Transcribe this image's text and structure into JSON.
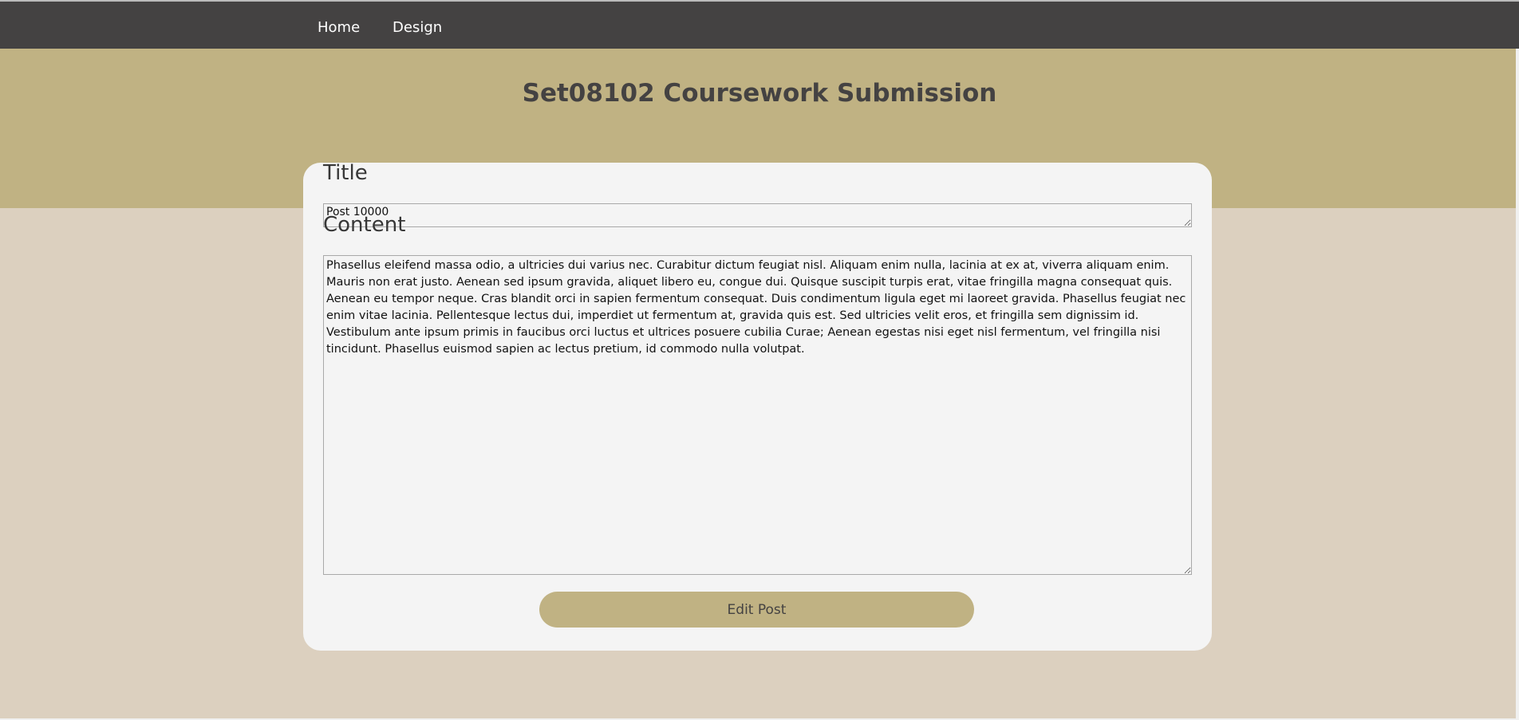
{
  "nav": {
    "items": [
      {
        "label": "Home"
      },
      {
        "label": "Design"
      }
    ]
  },
  "header": {
    "title": "Set08102 Coursework Submission"
  },
  "form": {
    "title_label": "Title",
    "title_value": "Post 10000",
    "content_label": "Content",
    "content_value": "Phasellus eleifend massa odio, a ultricies dui varius nec. Curabitur dictum feugiat nisl. Aliquam enim nulla, lacinia at ex at, viverra aliquam enim. Mauris non erat justo. Aenean sed ipsum gravida, aliquet libero eu, congue dui. Quisque suscipit turpis erat, vitae fringilla magna consequat quis. Aenean eu tempor neque. Cras blandit orci in sapien fermentum consequat. Duis condimentum ligula eget mi laoreet gravida. Phasellus feugiat nec enim vitae lacinia. Pellentesque lectus dui, imperdiet ut fermentum at, gravida quis est. Sed ultricies velit eros, et fringilla sem dignissim id. Vestibulum ante ipsum primis in faucibus orci luctus et ultrices posuere cubilia Curae; Aenean egestas nisi eget nisl fermentum, vel fringilla nisi tincidunt. Phasellus euismod sapien ac lectus pretium, id commodo nulla volutpat.",
    "submit_label": "Edit Post"
  },
  "colors": {
    "nav": "#444242",
    "accent": "#c0b283",
    "background": "#dcd0bf",
    "card": "#f4f4f4"
  }
}
